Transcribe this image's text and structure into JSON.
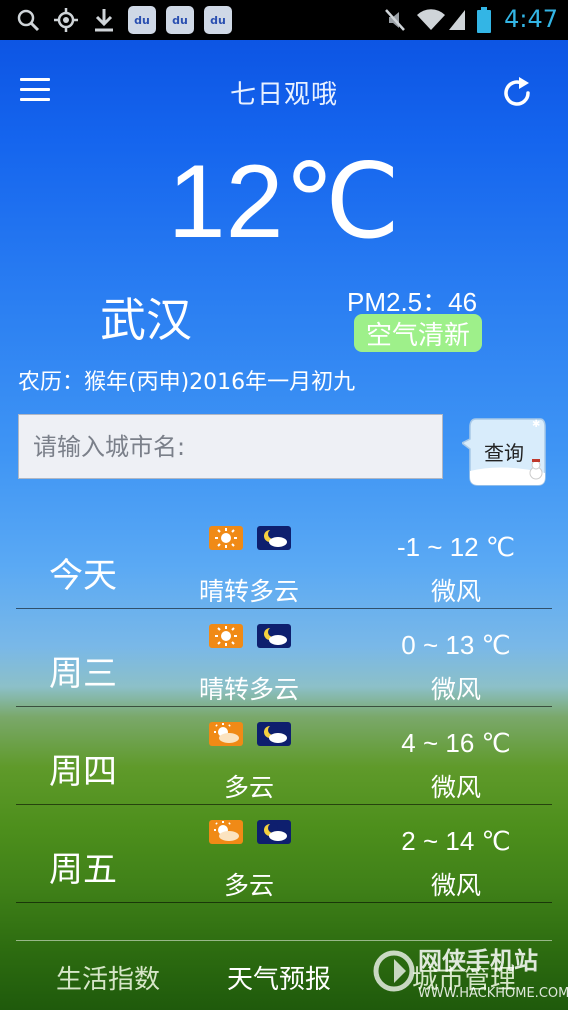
{
  "status_bar": {
    "time": "4:47",
    "icons": [
      "search-icon",
      "gps-icon",
      "download-icon",
      "baidu-icon",
      "baidu-icon",
      "baidu-icon",
      "mute-icon",
      "wifi-icon",
      "signal-icon",
      "battery-icon"
    ],
    "baidu_label": "du"
  },
  "app_bar": {
    "title": "七日观哦",
    "menu_icon": "menu-icon",
    "refresh_icon": "refresh-icon"
  },
  "current": {
    "temperature": "12℃",
    "city": "武汉",
    "pm25": "PM2.5：46",
    "air_quality": "空气清新",
    "lunar_date": "农历：猴年(丙申)2016年一月初九"
  },
  "search": {
    "placeholder": "请输入城市名:",
    "value": "",
    "button_label": "查询"
  },
  "forecast": [
    {
      "day": "今天",
      "icons": [
        "sunny-icon",
        "night-cloudy-icon"
      ],
      "condition": "晴转多云",
      "temp_range": "-1 ~ 12 ℃",
      "wind": "微风"
    },
    {
      "day": "周三",
      "icons": [
        "sunny-icon",
        "night-cloudy-icon"
      ],
      "condition": "晴转多云",
      "temp_range": "0 ~ 13 ℃",
      "wind": "微风"
    },
    {
      "day": "周四",
      "icons": [
        "partly-cloudy-icon",
        "night-cloudy-icon"
      ],
      "condition": "多云",
      "temp_range": "4 ~ 16 ℃",
      "wind": "微风"
    },
    {
      "day": "周五",
      "icons": [
        "partly-cloudy-icon",
        "night-cloudy-icon"
      ],
      "condition": "多云",
      "temp_range": "2 ~ 14 ℃",
      "wind": "微风"
    }
  ],
  "tabs": [
    {
      "label": "生活指数",
      "active": false
    },
    {
      "label": "天气预报",
      "active": true
    },
    {
      "label": "城市管理",
      "active": false
    }
  ],
  "watermark": {
    "line1": "网侠手机站",
    "line2": "WWW.HACKHOME.COM"
  },
  "colors": {
    "status_time": "#33b5e5",
    "air_quality_bg": "#9ef08a",
    "sun_icon_bg": "#f08a16",
    "moon_icon_bg": "#0e1f6e"
  }
}
